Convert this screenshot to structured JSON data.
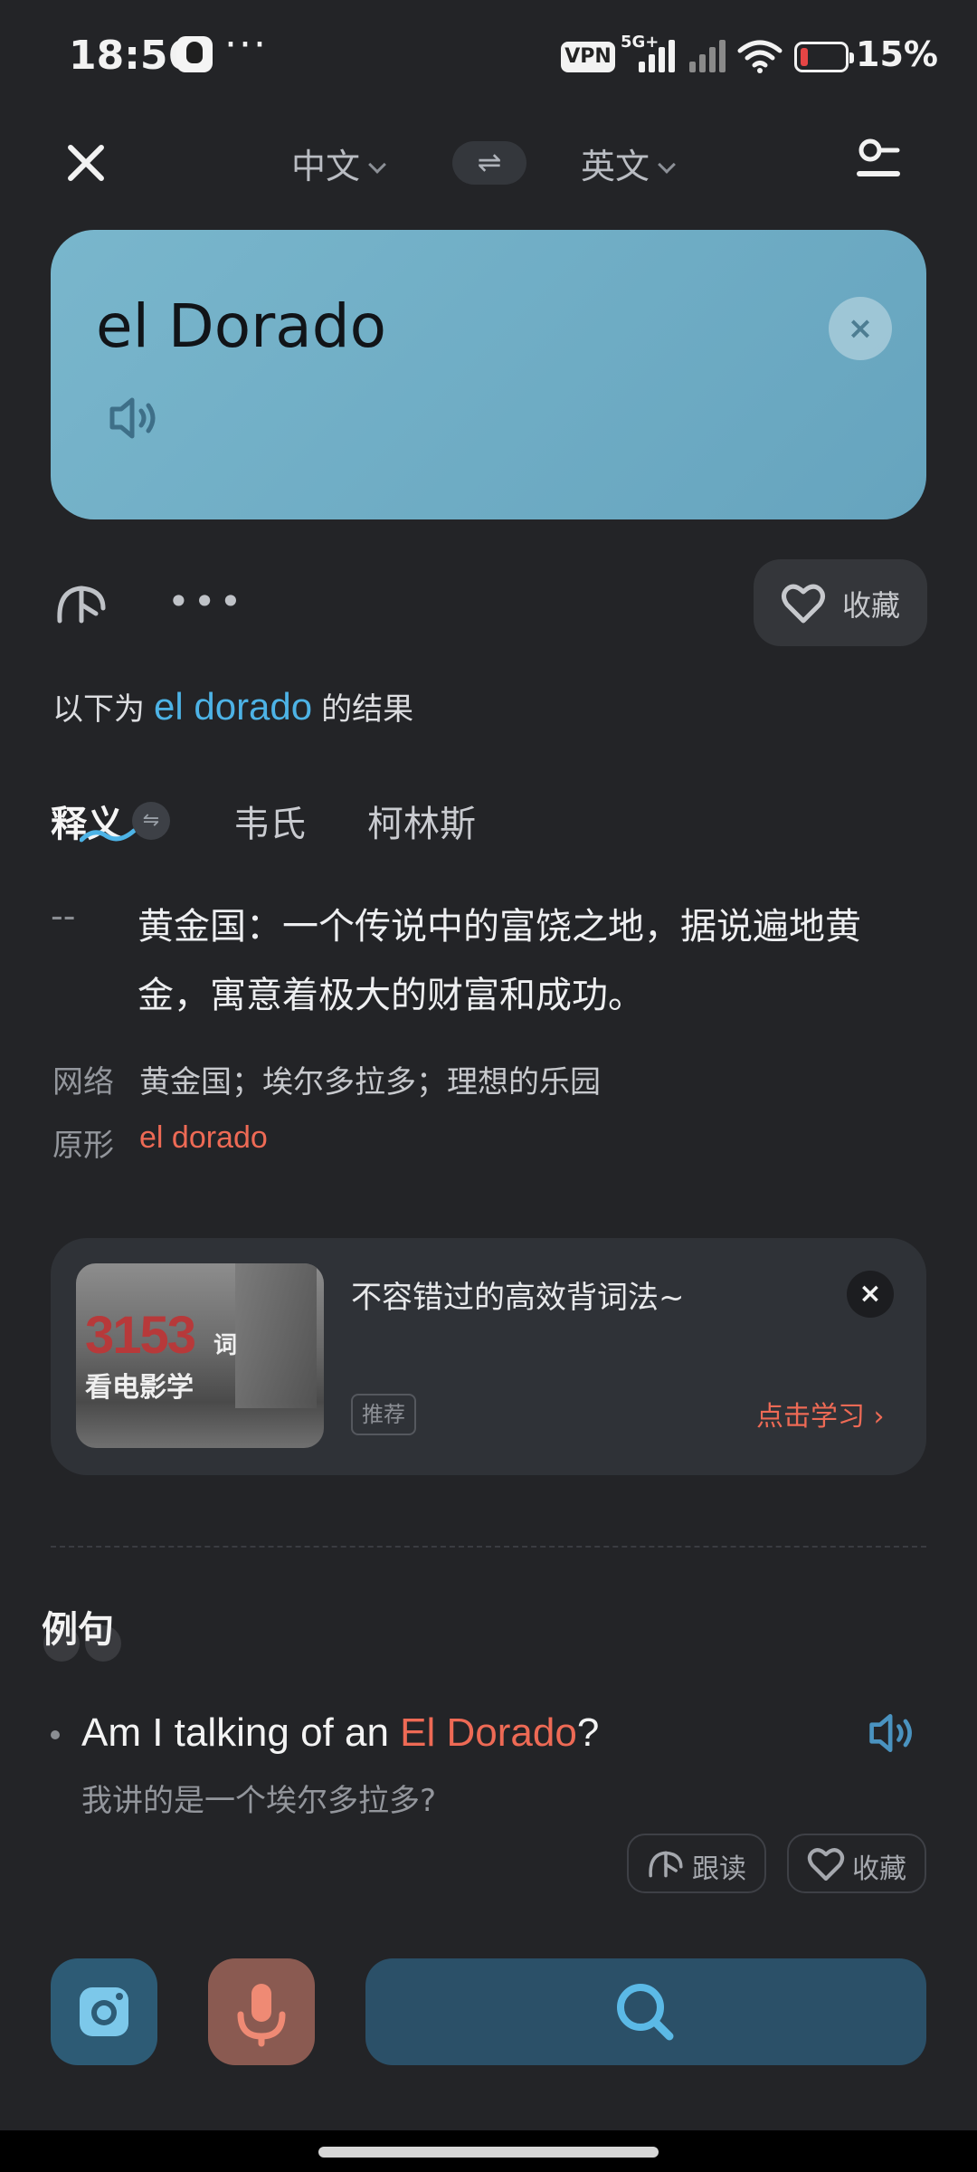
{
  "status_bar": {
    "time": "18:56",
    "dots": "···",
    "vpn": "VPN",
    "network": "5G+",
    "battery_pct": "15%"
  },
  "header": {
    "source_lang": "中文",
    "target_lang": "英文",
    "swap_symbol": "⇌"
  },
  "query": {
    "text": "el Dorado",
    "clear_symbol": "×"
  },
  "actions": {
    "more": "•••",
    "favorite_label": "收藏"
  },
  "result_line": {
    "prefix": "以下为",
    "keyword": "el dorado",
    "suffix": "的结果"
  },
  "tabs": [
    {
      "label": "释义",
      "active": true
    },
    {
      "label": "韦氏",
      "active": false
    },
    {
      "label": "柯林斯",
      "active": false
    }
  ],
  "tab_swap_symbol": "⇋",
  "definition": {
    "dash": "--",
    "text": "黄金国：一个传说中的富饶之地，据说遍地黄金，寓意着极大的财富和成功。",
    "network_label": "网络",
    "network_value": "黄金国；埃尔多拉多；理想的乐园",
    "lemma_label": "原形",
    "lemma_value": "el dorado"
  },
  "ad": {
    "thumb_number": "3153",
    "thumb_ci": "词",
    "thumb_sub": "看电影学",
    "title": "不容错过的高效背词法~",
    "tag": "推荐",
    "link": "点击学习 ›",
    "close_symbol": "×"
  },
  "examples": {
    "heading": "例句",
    "items": [
      {
        "en_before": "Am I talking of an ",
        "en_highlight": "El Dorado",
        "en_after": "?",
        "cn": "我讲的是一个埃尔多拉多?",
        "follow_label": "跟读",
        "favorite_label": "收藏"
      }
    ]
  },
  "colors": {
    "background": "#232427",
    "card": "#6ea9c1",
    "accent_blue": "#4db3e6",
    "accent_red": "#ee6a55"
  },
  "icons": [
    "close-icon",
    "chevron-down-icon",
    "swap-icon",
    "settings-icon",
    "speaker-icon",
    "tool-icon",
    "more-icon",
    "heart-icon",
    "camera-icon",
    "mic-icon",
    "search-icon"
  ]
}
